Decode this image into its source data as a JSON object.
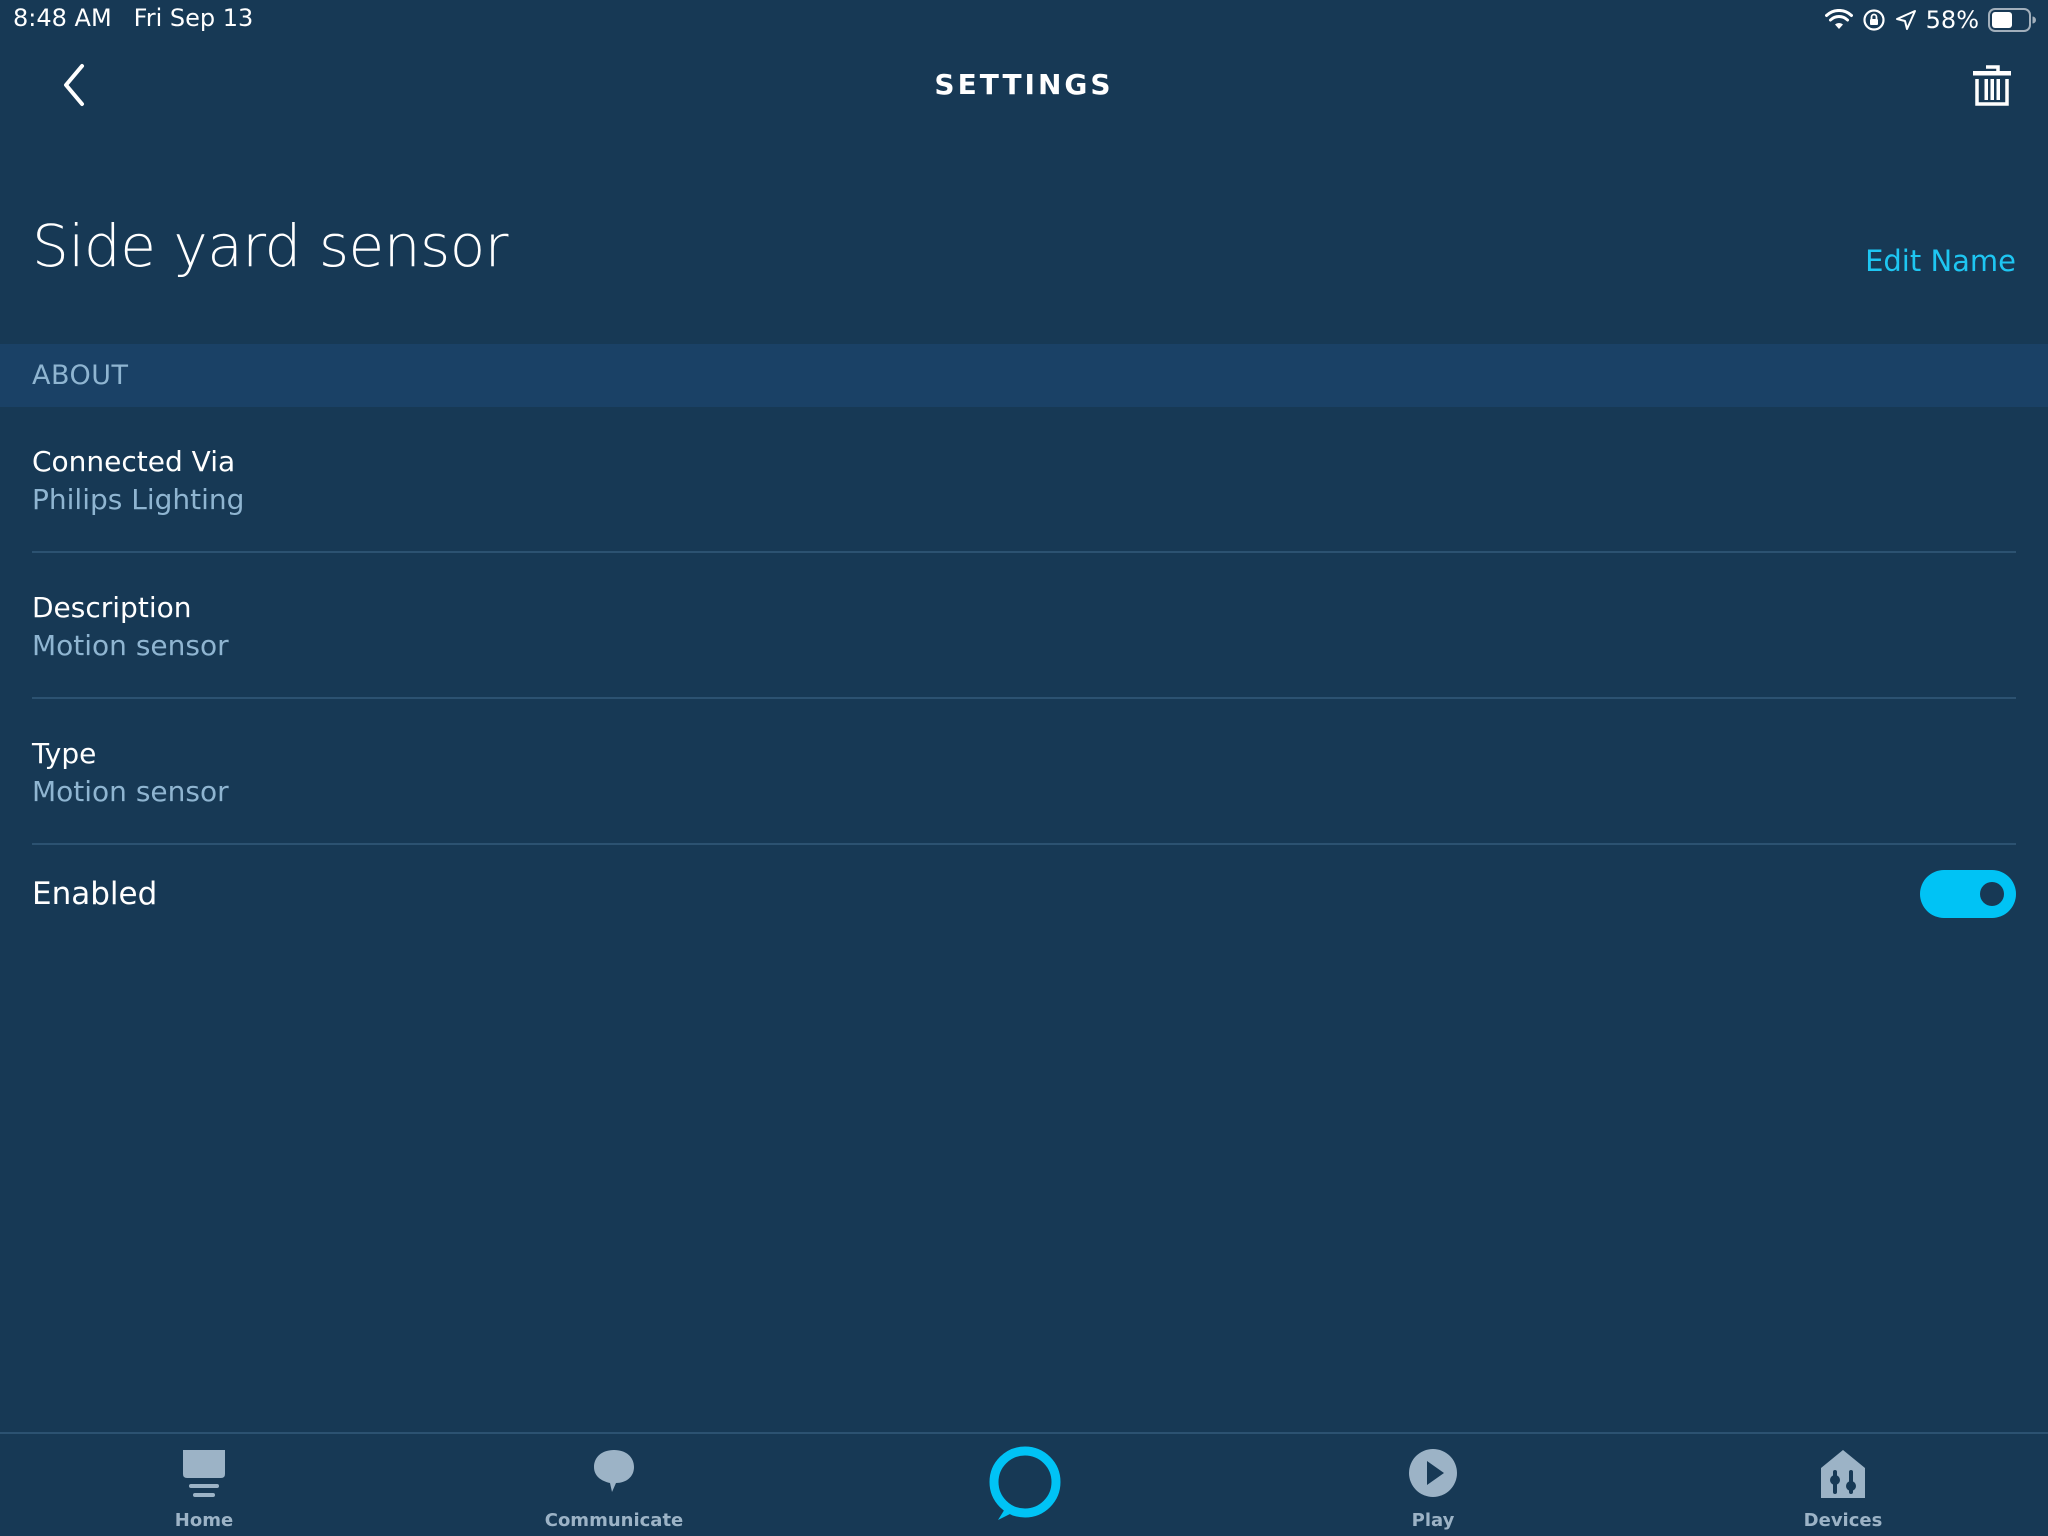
{
  "status_bar": {
    "time": "8:48 AM",
    "date": "Fri Sep 13",
    "battery_text": "58%",
    "battery_level": 0.58,
    "icons": [
      "wifi-icon",
      "orientation-lock-icon",
      "location-icon",
      "battery-icon"
    ]
  },
  "header": {
    "title": "SETTINGS",
    "back_icon": "chevron-left-icon",
    "delete_icon": "trash-icon"
  },
  "device": {
    "name": "Side yard sensor",
    "edit_label": "Edit Name"
  },
  "about": {
    "section_title": "ABOUT",
    "rows": [
      {
        "label": "Connected Via",
        "value": "Philips Lighting"
      },
      {
        "label": "Description",
        "value": "Motion sensor"
      },
      {
        "label": "Type",
        "value": "Motion sensor"
      }
    ]
  },
  "enabled": {
    "label": "Enabled",
    "on": true
  },
  "tabs": [
    {
      "label": "Home",
      "icon": "home-icon"
    },
    {
      "label": "Communicate",
      "icon": "chat-bubble-icon"
    },
    {
      "label": "",
      "icon": "alexa-ring-icon"
    },
    {
      "label": "Play",
      "icon": "play-icon"
    },
    {
      "label": "Devices",
      "icon": "devices-icon"
    }
  ],
  "colors": {
    "background": "#173955",
    "section_background": "#1a4166",
    "accent": "#00c3f5",
    "link": "#1ec6f2",
    "secondary_text": "#8fb5d1",
    "tab_inactive": "#9cb3c6"
  }
}
